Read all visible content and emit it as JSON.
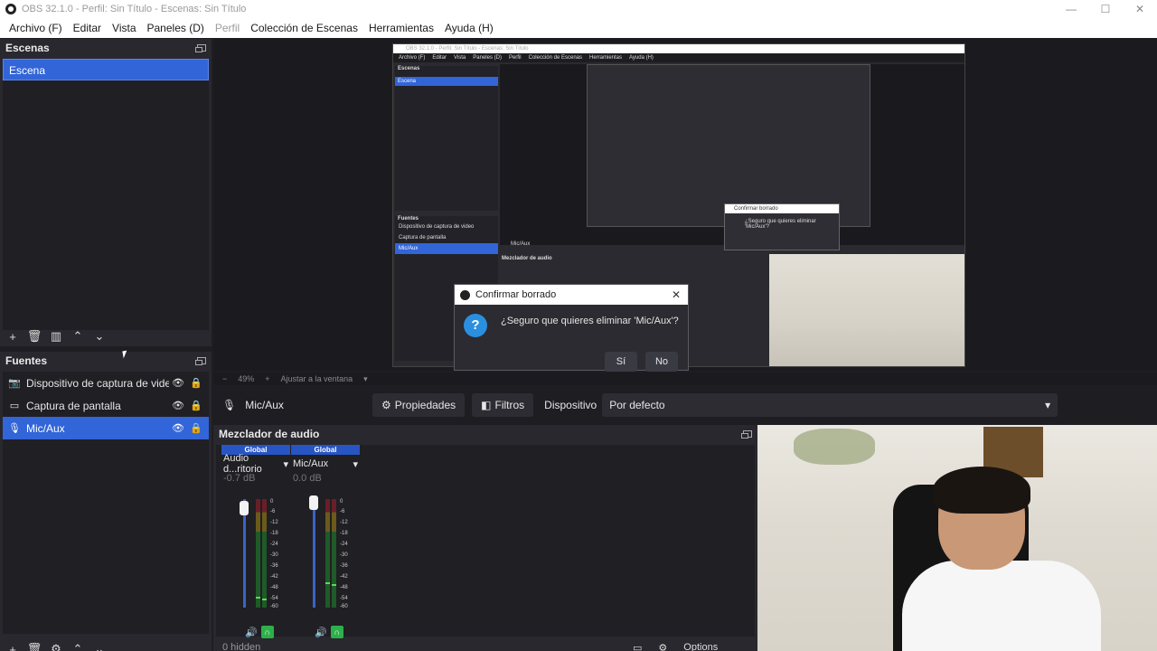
{
  "window": {
    "title": "OBS 32.1.0 - Perfil: Sin Título - Escenas: Sin Título",
    "controls": [
      "—",
      "☐",
      "✕"
    ]
  },
  "menubar": {
    "items": [
      {
        "label": "Archivo (F)",
        "disabled": false
      },
      {
        "label": "Editar",
        "disabled": false
      },
      {
        "label": "Vista",
        "disabled": false
      },
      {
        "label": "Paneles (D)",
        "disabled": false
      },
      {
        "label": "Perfil",
        "disabled": true
      },
      {
        "label": "Colección de Escenas",
        "disabled": false
      },
      {
        "label": "Herramientas",
        "disabled": false
      },
      {
        "label": "Ayuda (H)",
        "disabled": false
      }
    ]
  },
  "scenes": {
    "title": "Escenas",
    "items": [
      "Escena"
    ]
  },
  "sources": {
    "title": "Fuentes",
    "items": [
      {
        "name": "Dispositivo de captura de video",
        "icon": "camera-icon"
      },
      {
        "name": "Captura de pantalla",
        "icon": "monitor-icon"
      },
      {
        "name": "Mic/Aux",
        "icon": "microphone-icon",
        "selected": true
      }
    ]
  },
  "preview": {
    "nested_title": "OBS 32.1.0 - Perfil: Sin Título - Escenas: Sin Título",
    "nested_menu": [
      "Archivo (F)",
      "Editar",
      "Vista",
      "Paneles (D)",
      "Perfil",
      "Colección de Escenas",
      "Herramientas",
      "Ayuda (H)"
    ],
    "nested_scenes_title": "Escenas",
    "nested_scene": "Escena",
    "nested_sources_title": "Fuentes",
    "nested_sources": [
      "Dispositivo de captura de video",
      "Captura de pantalla",
      "Mic/Aux"
    ],
    "nested_dialog_title": "Confirmar borrado",
    "nested_dialog_msg": "¿Seguro que quieres eliminar 'Mic/Aux'?",
    "nested_context_source": "Mic/Aux",
    "nested_mixer_title": "Mezclador de audio",
    "zoom": "49%",
    "fit_label": "Ajustar a la ventana"
  },
  "context_bar": {
    "source": "Mic/Aux",
    "properties": "Propiedades",
    "filters": "Filtros",
    "device_label": "Dispositivo",
    "device_value": "Por defecto"
  },
  "mixer": {
    "title": "Mezclador de audio",
    "channels": [
      {
        "badge": "Global",
        "name": "Audio d...ritorio",
        "db": "-0.7 dB"
      },
      {
        "badge": "Global",
        "name": "Mic/Aux",
        "db": "0.0 dB"
      }
    ],
    "scale": [
      "0",
      "-6",
      "-12",
      "-18",
      "-24",
      "-30",
      "-36",
      "-42",
      "-48",
      "-54",
      "-60"
    ],
    "hidden": "0 hidden",
    "options": "Options"
  },
  "dialog": {
    "title": "Confirmar borrado",
    "message": "¿Seguro que quieres eliminar 'Mic/Aux'?",
    "yes": "Sí",
    "no": "No"
  }
}
